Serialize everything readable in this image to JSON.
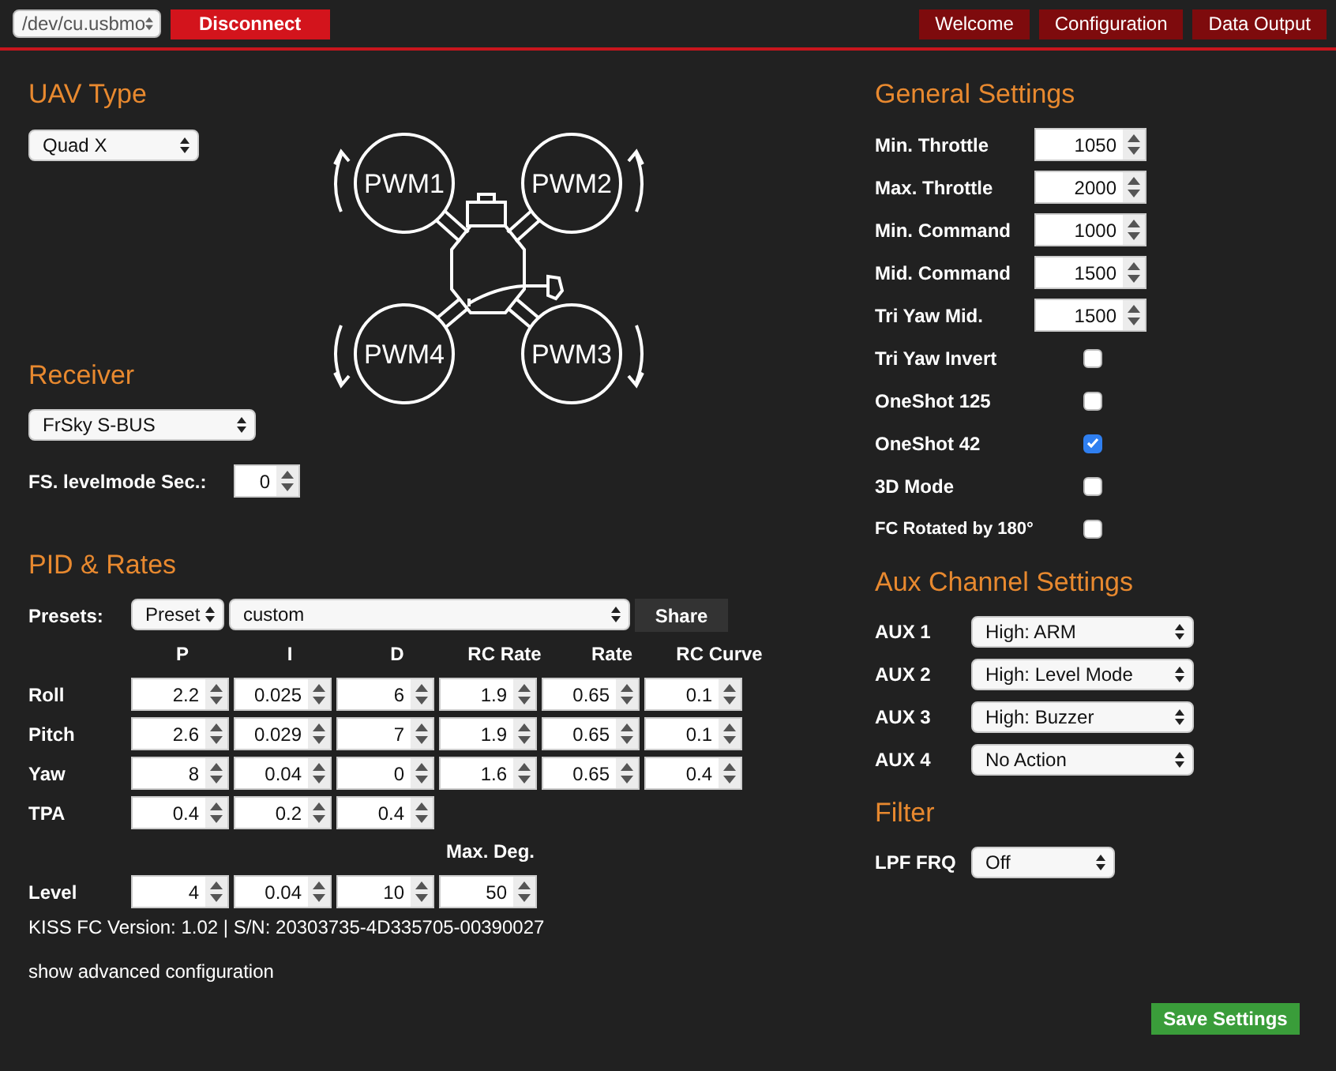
{
  "top_bar": {
    "port": "/dev/cu.usbmo",
    "connect_button": "Disconnect",
    "nav": [
      "Welcome",
      "Configuration",
      "Data Output"
    ]
  },
  "uav_type": {
    "title": "UAV Type",
    "value": "Quad X",
    "motors": [
      "PWM1",
      "PWM2",
      "PWM4",
      "PWM3"
    ]
  },
  "receiver": {
    "title": "Receiver",
    "value": "FrSky S-BUS",
    "failsafe_label": "FS. levelmode Sec.:",
    "failsafe_value": "0"
  },
  "pid": {
    "title": "PID & Rates",
    "presets_label": "Presets:",
    "preset": "Preset",
    "preset_name": "custom",
    "share_button": "Share",
    "columns": [
      "P",
      "I",
      "D",
      "RC Rate",
      "Rate",
      "RC Curve"
    ],
    "rows": [
      {
        "label": "Roll",
        "values": [
          "2.2",
          "0.025",
          "6",
          "1.9",
          "0.65",
          "0.1"
        ]
      },
      {
        "label": "Pitch",
        "values": [
          "2.6",
          "0.029",
          "7",
          "1.9",
          "0.65",
          "0.1"
        ]
      },
      {
        "label": "Yaw",
        "values": [
          "8",
          "0.04",
          "0",
          "1.6",
          "0.65",
          "0.4"
        ]
      },
      {
        "label": "TPA",
        "values": [
          "0.4",
          "0.2",
          "0.4"
        ]
      }
    ],
    "level_header": "Max. Deg.",
    "level": {
      "label": "Level",
      "values": [
        "4",
        "0.04",
        "10",
        "50"
      ]
    }
  },
  "version": "KISS FC Version: 1.02 | S/N: 20303735-4D335705-00390027",
  "advanced_link": "show advanced configuration",
  "general": {
    "title": "General Settings",
    "fields": [
      {
        "kind": "number",
        "label": "Min. Throttle",
        "value": "1050"
      },
      {
        "kind": "number",
        "label": "Max. Throttle",
        "value": "2000"
      },
      {
        "kind": "number",
        "label": "Min. Command",
        "value": "1000"
      },
      {
        "kind": "number",
        "label": "Mid. Command",
        "value": "1500"
      },
      {
        "kind": "number",
        "label": "Tri Yaw Mid.",
        "value": "1500"
      },
      {
        "kind": "checkbox",
        "label": "Tri Yaw Invert",
        "checked": false
      },
      {
        "kind": "checkbox",
        "label": "OneShot 125",
        "checked": false
      },
      {
        "kind": "checkbox",
        "label": "OneShot 42",
        "checked": true
      },
      {
        "kind": "checkbox",
        "label": "3D Mode",
        "checked": false
      },
      {
        "kind": "checkbox",
        "label": "FC Rotated by 180°",
        "checked": false
      }
    ]
  },
  "aux": {
    "title": "Aux Channel Settings",
    "channels": [
      {
        "label": "AUX 1",
        "value": "High: ARM"
      },
      {
        "label": "AUX 2",
        "value": "High: Level Mode"
      },
      {
        "label": "AUX 3",
        "value": "High: Buzzer"
      },
      {
        "label": "AUX 4",
        "value": "No Action"
      }
    ]
  },
  "filter": {
    "title": "Filter",
    "label": "LPF FRQ",
    "value": "Off"
  },
  "save_button": "Save Settings"
}
